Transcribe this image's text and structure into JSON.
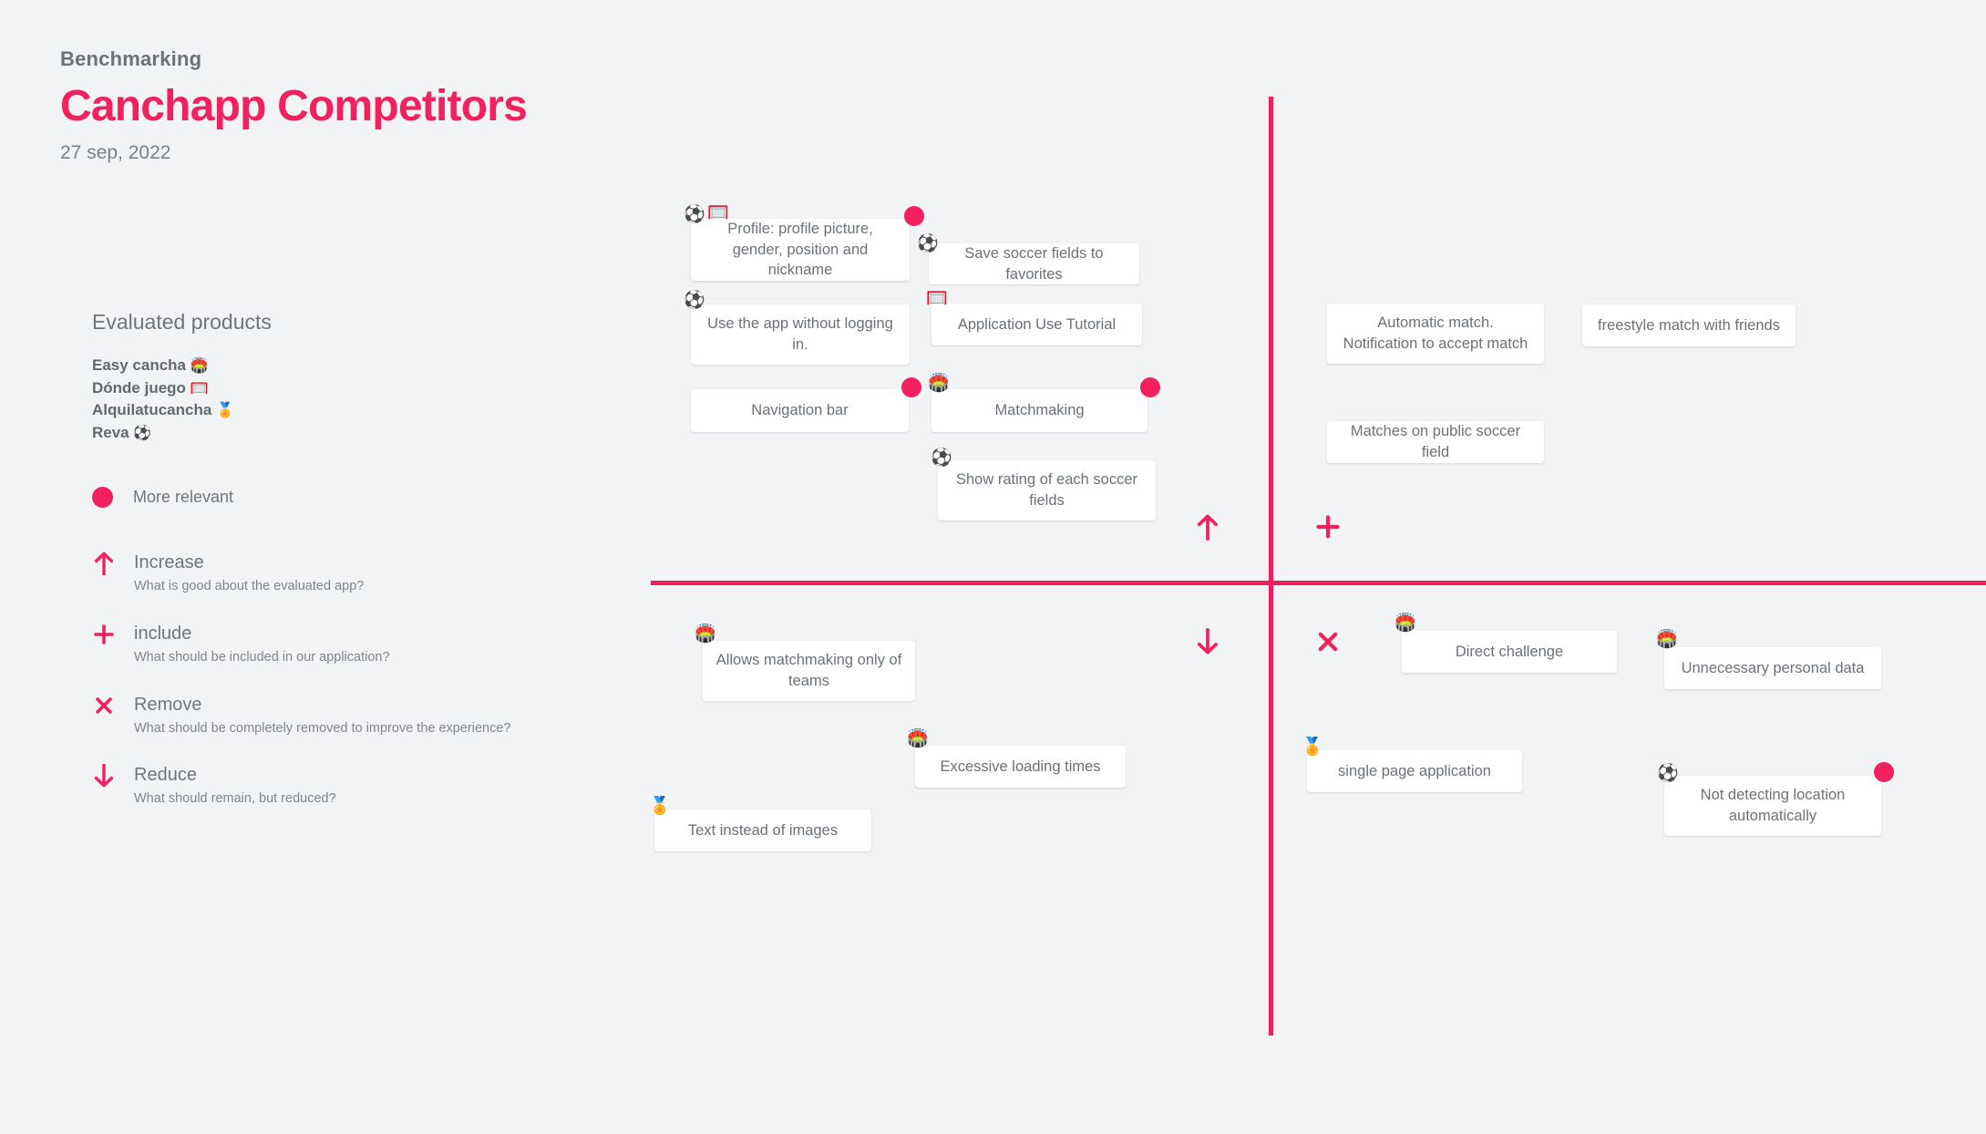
{
  "header": {
    "eyebrow": "Benchmarking",
    "title": "Canchapp Competitors",
    "date": "27 sep, 2022"
  },
  "colors": {
    "accent": "#f2205e",
    "background": "#f2f3f5",
    "card": "#ffffff",
    "text": "#6f767c"
  },
  "legend": {
    "heading": "Evaluated products",
    "products": [
      {
        "name": "Easy cancha",
        "emoji": "🏟️"
      },
      {
        "name": "Dónde juego",
        "emoji": "🥅"
      },
      {
        "name": "Alquilatucancha",
        "emoji": "🏅"
      },
      {
        "name": "Reva",
        "emoji": "⚽"
      }
    ],
    "relevant_label": "More relevant",
    "items": [
      {
        "icon": "arrow-up-icon",
        "title": "Increase",
        "subtitle": "What is good about the evaluated app?"
      },
      {
        "icon": "plus-icon",
        "title": "include",
        "subtitle": "What should be included in our application?"
      },
      {
        "icon": "cross-icon",
        "title": "Remove",
        "subtitle": "What should be completely removed to improve the experience?"
      },
      {
        "icon": "arrow-down-icon",
        "title": "Reduce",
        "subtitle": "What should remain, but reduced?"
      }
    ]
  },
  "quadrants": {
    "increase": {
      "marker": "arrow-up-icon"
    },
    "include": {
      "marker": "plus-icon"
    },
    "reduce": {
      "marker": "arrow-down-icon"
    },
    "remove": {
      "marker": "cross-icon"
    }
  },
  "cards": [
    {
      "text": "Profile: profile picture, gender, position and nickname",
      "emojis": [
        "⚽",
        "🥅"
      ],
      "relevant": true,
      "quadrant": "increase"
    },
    {
      "text": "Save soccer fields to favorites",
      "emojis": [
        "⚽"
      ],
      "relevant": false,
      "quadrant": "increase"
    },
    {
      "text": "Use the app without logging in.",
      "emojis": [
        "⚽"
      ],
      "relevant": false,
      "quadrant": "increase"
    },
    {
      "text": "Application Use Tutorial",
      "emojis": [
        "🥅"
      ],
      "relevant": false,
      "quadrant": "increase"
    },
    {
      "text": "Navigation bar",
      "emojis": [],
      "relevant": true,
      "quadrant": "increase"
    },
    {
      "text": "Matchmaking",
      "emojis": [
        "🏟️"
      ],
      "relevant": true,
      "quadrant": "increase"
    },
    {
      "text": "Show rating of each soccer fields",
      "emojis": [
        "⚽"
      ],
      "relevant": false,
      "quadrant": "increase"
    },
    {
      "text": "Automatic match. Notification to accept match",
      "emojis": [],
      "relevant": false,
      "quadrant": "include"
    },
    {
      "text": "freestyle match with friends",
      "emojis": [],
      "relevant": false,
      "quadrant": "include"
    },
    {
      "text": "Matches on public soccer field",
      "emojis": [],
      "relevant": false,
      "quadrant": "include"
    },
    {
      "text": "Allows matchmaking only of teams",
      "emojis": [
        "🏟️"
      ],
      "relevant": false,
      "quadrant": "reduce"
    },
    {
      "text": "Excessive loading times",
      "emojis": [
        "🏟️"
      ],
      "relevant": false,
      "quadrant": "reduce"
    },
    {
      "text": "Text instead of images",
      "emojis": [
        "🏅"
      ],
      "relevant": false,
      "quadrant": "reduce"
    },
    {
      "text": "Direct challenge",
      "emojis": [
        "🏟️"
      ],
      "relevant": false,
      "quadrant": "remove"
    },
    {
      "text": "Unnecessary personal data",
      "emojis": [
        "🏟️"
      ],
      "relevant": false,
      "quadrant": "remove"
    },
    {
      "text": "single page application",
      "emojis": [
        "🏅"
      ],
      "relevant": false,
      "quadrant": "remove"
    },
    {
      "text": "Not detecting location automatically",
      "emojis": [
        "⚽"
      ],
      "relevant": true,
      "quadrant": "remove"
    }
  ]
}
